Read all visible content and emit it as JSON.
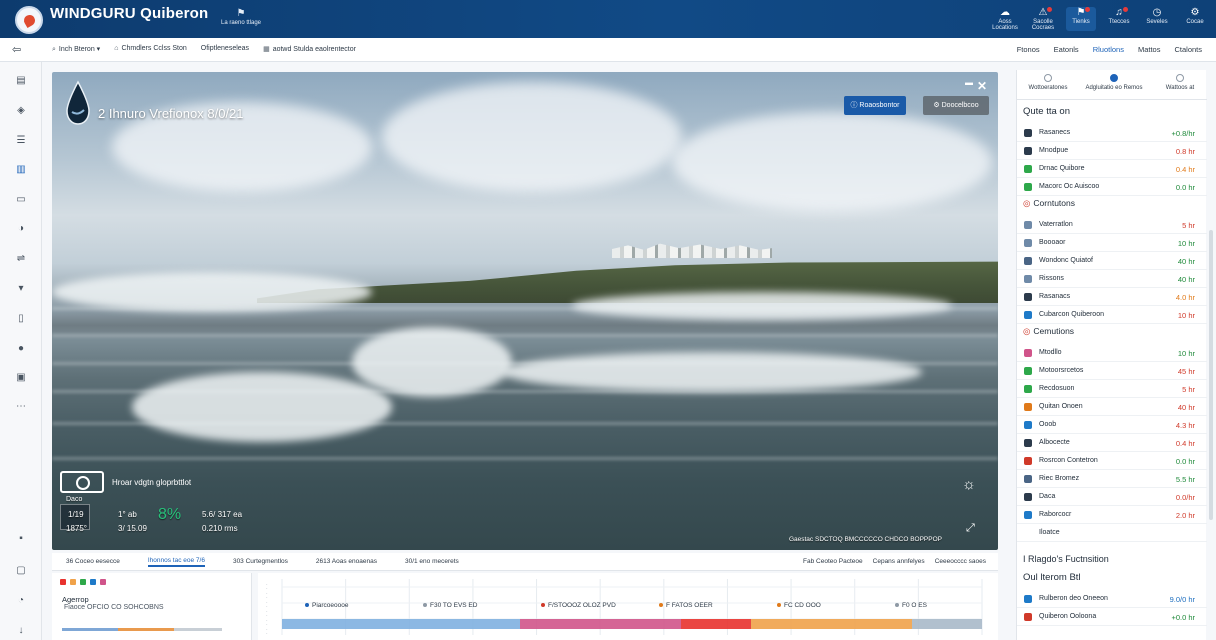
{
  "header": {
    "brand": "WINDGURU Quiberon",
    "brand_sub": "",
    "center_label": "La raeno ttlage",
    "right_items": [
      {
        "label": "Aoss Locations",
        "icon": "cloud-icon"
      },
      {
        "label": "Sacolle Cocraes",
        "icon": "alert-icon"
      },
      {
        "label": "Tienks",
        "icon": "flag-icon"
      },
      {
        "label": "Ttecces",
        "icon": "bell-icon"
      },
      {
        "label": "Seveles",
        "icon": "clock-icon"
      },
      {
        "label": "Cocae",
        "icon": "gear-icon"
      }
    ]
  },
  "subnav": {
    "breadcrumbs": [
      "Inch Bteron",
      "Chmdlers Cclss Ston",
      "Ofiptleneseleas",
      "aotwd Stulda eaolrentector"
    ],
    "view_tabs": [
      "Ftonos",
      "Eatonls",
      "Rluotlons",
      "Mattos",
      "Ctalonts"
    ],
    "active_view": "Rluotlons"
  },
  "webcam": {
    "title": "2 Ihnuro Vrefionox 8/0/21",
    "button_primary": "Roaosbontor",
    "button_secondary": "Doocelbcoo",
    "live_label": "Hroar vdgtn gloprbttlot",
    "stats": {
      "a_label": "Daco",
      "a_value": "1/19",
      "a_sub": "1875°",
      "b_label": "1° ab",
      "b_value": "3/ 15.09",
      "c_value": "8%",
      "d_value": "5.6/ 317 ea",
      "d_sub": "0.210 rms"
    },
    "caption": "Gaestac SDCTOQ BMCCCCCO CHDCO BOPPPOP"
  },
  "bottom_tabs": {
    "items": [
      "36 Coceo eesecce",
      "Ihonnos tac eoe 7/6",
      "303 Curtegmentlos",
      "2613 Aoas enoaenas",
      "30/1 eno mecerets"
    ],
    "active": "Ihonnos tac eoe 7/6",
    "right": [
      "Fab Ceoteo Pacteoe",
      "Cepans annfelyes",
      "Ceeeocccc saoes"
    ]
  },
  "bottom_left": {
    "title": "Agerrop",
    "sub": "Fiaoce OFCIO CO SOHCOBNS"
  },
  "chart_data": {
    "type": "area",
    "title": "",
    "series_labels": [
      "Piarcoeoooe",
      "F30 TO EVS ED",
      "F/STOOOZ OLOZ PVD",
      "F FATOS OEER",
      "FC CD OOO",
      "F0 O ES"
    ],
    "bands": [
      {
        "color": "#7fb0e0",
        "from": 0.0,
        "to": 0.34
      },
      {
        "color": "#d0548a",
        "from": 0.34,
        "to": 0.57
      },
      {
        "color": "#e8322e",
        "from": 0.57,
        "to": 0.67
      },
      {
        "color": "#f0a24a",
        "from": 0.67,
        "to": 0.9
      },
      {
        "color": "#a9b9c9",
        "from": 0.9,
        "to": 1.0
      }
    ],
    "ticks": [
      "-",
      "-",
      "-",
      "-",
      "-",
      "-",
      "-",
      "-",
      "-",
      "-",
      "-",
      "-"
    ]
  },
  "right_panel": {
    "tabs": [
      "Wottoeratones",
      "Adgluitatio eo Remos",
      "Wattoos at"
    ],
    "active_tab": "Adgluitatio eo Remos",
    "section1": {
      "title": "Qute tta on",
      "rows": [
        {
          "label": "Rasanecs",
          "value": "+0.8/hr",
          "color": "#1f8a3a",
          "icon_color": "#2c3b4c"
        },
        {
          "label": "Mnodpue",
          "value": "0.8 hr",
          "color": "#d03a2a",
          "icon_color": "#2c3b4c"
        },
        {
          "label": "Drnac Quibore",
          "value": "0.4 hr",
          "color": "#e07a1a",
          "icon_color": "#2ea84a"
        },
        {
          "label": "Macorc Oc Auiscoo",
          "value": "0.0 hr",
          "color": "#1f8a3a",
          "icon_color": "#2ea84a"
        }
      ]
    },
    "section2": {
      "title": "Corntutons",
      "rows": [
        {
          "label": "Vaterratlon",
          "value": "5 hr",
          "color": "#d03a2a",
          "icon_color": "#6f8aa8"
        },
        {
          "label": "Boooaor",
          "value": "10 hr",
          "color": "#1f8a3a",
          "icon_color": "#6f8aa8"
        },
        {
          "label": "Wondonc Quiatof",
          "value": "40 hr",
          "color": "#1f8a3a",
          "icon_color": "#4a6585"
        },
        {
          "label": "Rissons",
          "value": "40 hr",
          "color": "#1f8a3a",
          "icon_color": "#6f8aa8"
        },
        {
          "label": "Rasanacs",
          "value": "4.0 hr",
          "color": "#e07a1a",
          "icon_color": "#2c3b4c"
        },
        {
          "label": "Cubarcon Quiberoon",
          "value": "10 hr",
          "color": "#d03a2a",
          "icon_color": "#1e7ac8"
        }
      ]
    },
    "section3": {
      "title": "Cemutions",
      "rows": [
        {
          "label": "Mtodllo",
          "value": "10 hr",
          "color": "#1f8a3a",
          "icon_color": "#d0548a"
        },
        {
          "label": "Motoorsrcetos",
          "value": "45 hr",
          "color": "#d03a2a",
          "icon_color": "#2ea84a"
        },
        {
          "label": "Recdosuon",
          "value": "5 hr",
          "color": "#d03a2a",
          "icon_color": "#2ea84a"
        },
        {
          "label": "Quitan Onoen",
          "value": "40 hr",
          "color": "#d03a2a",
          "icon_color": "#e07a1a"
        },
        {
          "label": "Ooob",
          "value": "4.3 hr",
          "color": "#d03a2a",
          "icon_color": "#1e7ac8"
        },
        {
          "label": "Albocecte",
          "value": "0.4 hr",
          "color": "#d03a2a",
          "icon_color": "#2c3b4c"
        },
        {
          "label": "Rosrcon Contetron",
          "value": "0.0 hr",
          "color": "#1f8a3a",
          "icon_color": "#d03a2a"
        },
        {
          "label": "Riec Bromez",
          "value": "5.5 hr",
          "color": "#1f8a3a",
          "icon_color": "#4a6585"
        },
        {
          "label": "Daca",
          "value": "0.0/hr",
          "color": "#d03a2a",
          "icon_color": "#2c3b4c"
        },
        {
          "label": "Raborcocr",
          "value": "2.0 hr",
          "color": "#d03a2a",
          "icon_color": "#1e7ac8"
        },
        {
          "label": "Iloatce",
          "value": "",
          "color": "#1f2b38",
          "icon_color": "#ffffff"
        }
      ]
    },
    "footer1": "I Rlagdo's Fuctnsition",
    "footer2": {
      "title": "Oul lterom Btl",
      "rows": [
        {
          "label": "Rulberon deo Oneeon",
          "value": "9.0/0 hr",
          "color": "#1f6fbf",
          "icon_color": "#1e7ac8"
        },
        {
          "label": "Quiberon Ooloona",
          "value": "+0.0 hr",
          "color": "#1f8a3a",
          "icon_color": "#d03a2a"
        }
      ]
    }
  }
}
